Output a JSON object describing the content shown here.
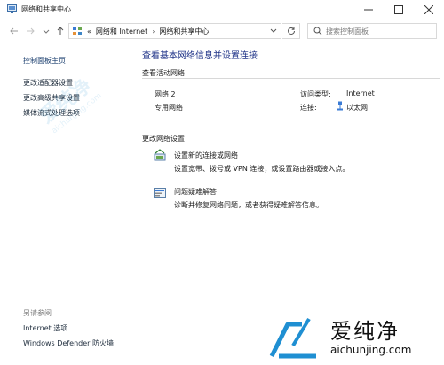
{
  "window": {
    "title": "网络和共享中心",
    "minimize_glyph": "—",
    "maximize_glyph": "☐",
    "close_glyph": "✕"
  },
  "nav": {
    "breadcrumb": [
      {
        "label": "«"
      },
      {
        "label": "网络和 Internet"
      },
      {
        "label": "网络和共享中心"
      }
    ],
    "separator": "›",
    "search_placeholder": "搜索控制面板"
  },
  "left_pane": {
    "home": "控制面板主页",
    "links": [
      "更改适配器设置",
      "更改高级共享设置",
      "媒体流式处理选项"
    ],
    "see_also_title": "另请参阅",
    "see_also_links": [
      "Internet 选项",
      "Windows Defender 防火墙"
    ]
  },
  "main": {
    "title": "查看基本网络信息并设置连接",
    "active_networks_title": "查看活动网络",
    "network": {
      "name": "网络 2",
      "type": "专用网络",
      "access_type_label": "访问类型:",
      "access_type_value": "Internet",
      "connections_label": "连接:",
      "connections_value": "以太网"
    },
    "change_settings_title": "更改网络设置",
    "actions": [
      {
        "icon": "new-connection-icon",
        "link": "设置新的连接或网络",
        "desc": "设置宽带、拨号或 VPN 连接；或设置路由器或接入点。"
      },
      {
        "icon": "troubleshoot-icon",
        "link": "问题疑难解答",
        "desc": "诊断并修复网络问题，或者获得疑难解答信息。"
      }
    ]
  },
  "watermark": {
    "brand_cn": "爱纯净",
    "brand_url": "aichunjing.com"
  },
  "colors": {
    "accent_link": "#0a5bc4",
    "title_blue": "#1e3287",
    "brand_blue": "#1f8fd2"
  }
}
